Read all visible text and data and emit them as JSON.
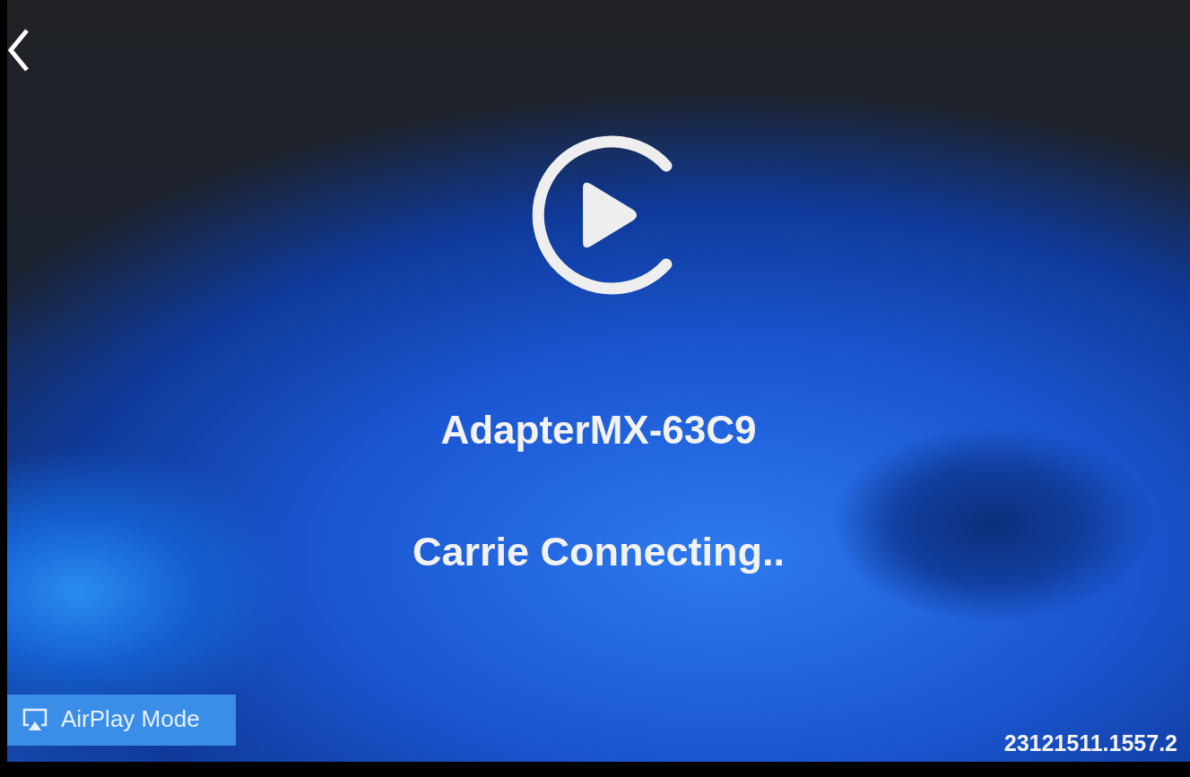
{
  "device_name": "AdapterMX-63C9",
  "status": "Carrie Connecting..",
  "mode_badge": {
    "label": "AirPlay Mode"
  },
  "version": "23121511.1557.2"
}
